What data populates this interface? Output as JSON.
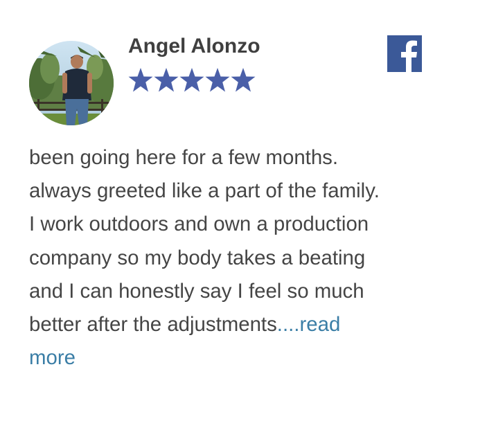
{
  "review": {
    "author": "Angel Alonzo",
    "rating": 5,
    "max_rating": 5,
    "lines": [
      "been going here for a few months.",
      "always greeted like a part of the family.",
      "I work outdoors and own a production",
      "company so my body takes a beating",
      "and I can honestly say I feel so much",
      "better after the adjustments"
    ],
    "read_more_label": "....read",
    "read_more_label_2": "more"
  },
  "icons": {
    "avatar": "reviewer-photo",
    "star": "star-icon",
    "source": "facebook-icon"
  },
  "colors": {
    "star": "#4a5fa8",
    "facebook": "#3b5998",
    "link": "#3b7ea6",
    "text": "#454545",
    "name": "#3f3f3f"
  }
}
